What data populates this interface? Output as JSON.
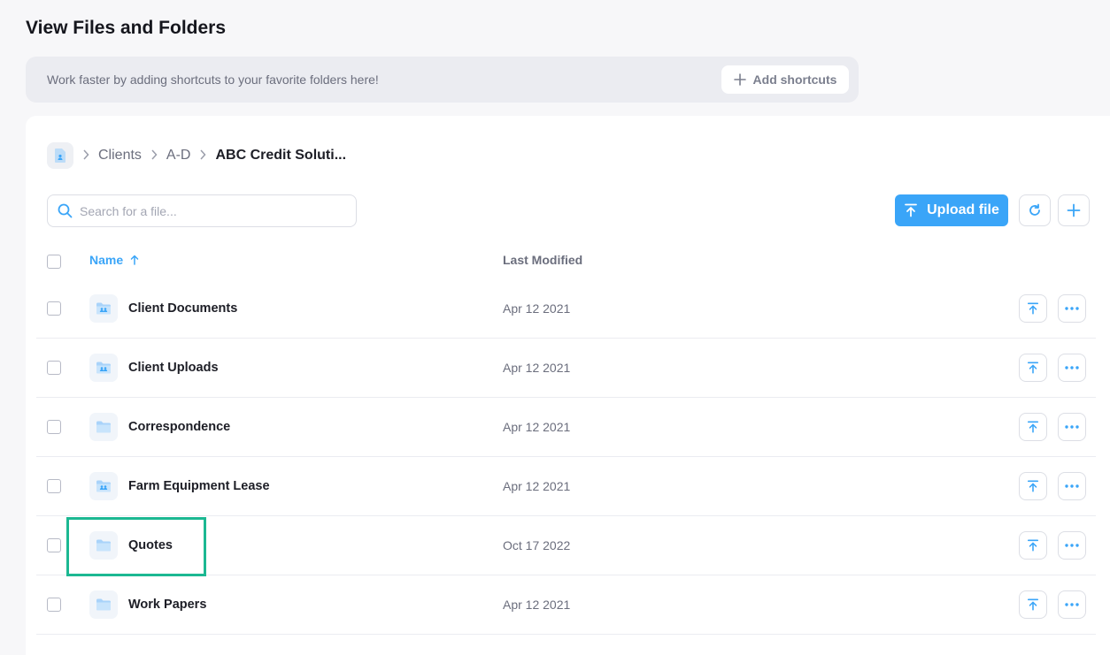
{
  "page": {
    "title": "View Files and Folders"
  },
  "shortcuts": {
    "message": "Work faster by adding shortcuts to your favorite folders here!",
    "add_label": "Add shortcuts"
  },
  "breadcrumb": {
    "items": [
      "Clients",
      "A-D",
      "ABC Credit Soluti..."
    ]
  },
  "search": {
    "placeholder": "Search for a file..."
  },
  "toolbar": {
    "upload_label": "Upload file"
  },
  "table": {
    "columns": {
      "name": "Name",
      "modified": "Last Modified"
    },
    "sort": "name-ascending",
    "rows": [
      {
        "name": "Client Documents",
        "modified": "Apr 12 2021",
        "icon": "shared-folder-icon"
      },
      {
        "name": "Client Uploads",
        "modified": "Apr 12 2021",
        "icon": "shared-folder-icon"
      },
      {
        "name": "Correspondence",
        "modified": "Apr 12 2021",
        "icon": "folder-icon"
      },
      {
        "name": "Farm Equipment Lease",
        "modified": "Apr 12 2021",
        "icon": "shared-folder-icon"
      },
      {
        "name": "Quotes",
        "modified": "Oct 17 2022",
        "icon": "folder-icon"
      },
      {
        "name": "Work Papers",
        "modified": "Apr 12 2021",
        "icon": "folder-icon"
      }
    ]
  },
  "colors": {
    "accent": "#3aa5f8",
    "highlight": "#1cb892",
    "background": "#f7f7f9"
  }
}
